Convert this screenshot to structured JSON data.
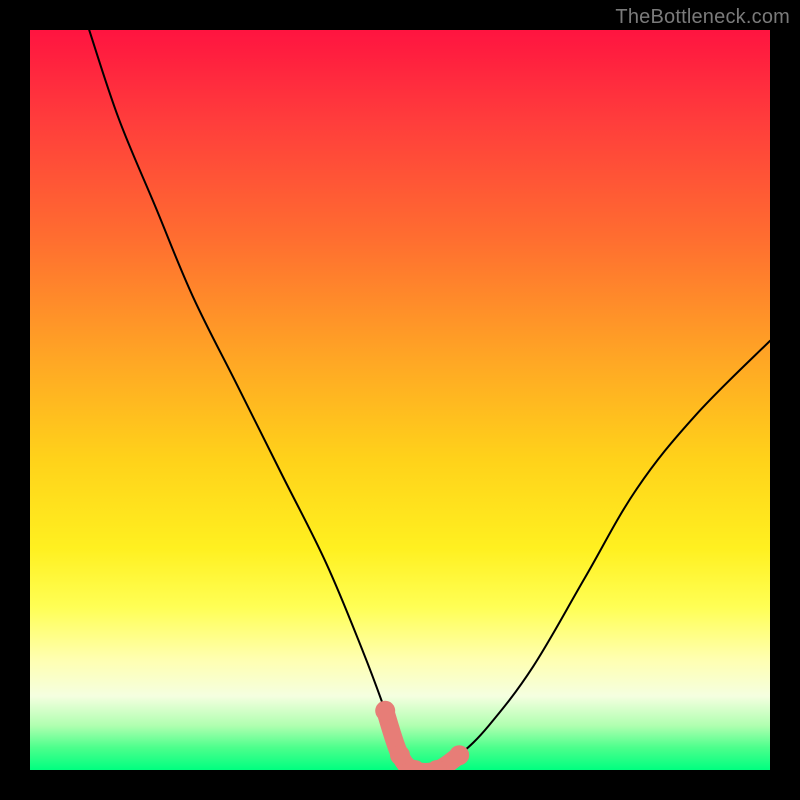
{
  "watermark": "TheBottleneck.com",
  "chart_data": {
    "type": "line",
    "title": "",
    "xlabel": "",
    "ylabel": "",
    "xlim": [
      0,
      100
    ],
    "ylim": [
      0,
      100
    ],
    "grid": false,
    "series": [
      {
        "name": "performance-curve",
        "x": [
          8,
          12,
          17,
          22,
          28,
          34,
          40,
          45,
          48,
          50,
          52,
          55,
          58,
          62,
          68,
          75,
          82,
          90,
          100
        ],
        "values": [
          100,
          88,
          76,
          64,
          52,
          40,
          28,
          16,
          8,
          2,
          0,
          0,
          2,
          6,
          14,
          26,
          38,
          48,
          58
        ]
      }
    ],
    "highlight": {
      "name": "optimal-zone",
      "color": "#e77d77",
      "x": [
        48,
        50,
        52,
        55,
        58
      ],
      "values": [
        8,
        2,
        0,
        0,
        2
      ]
    },
    "background_gradient": {
      "top": "#ff1440",
      "upper_mid": "#ffa824",
      "mid": "#ffff55",
      "lower_mid": "#b0ffb0",
      "bottom": "#00ff80"
    }
  }
}
